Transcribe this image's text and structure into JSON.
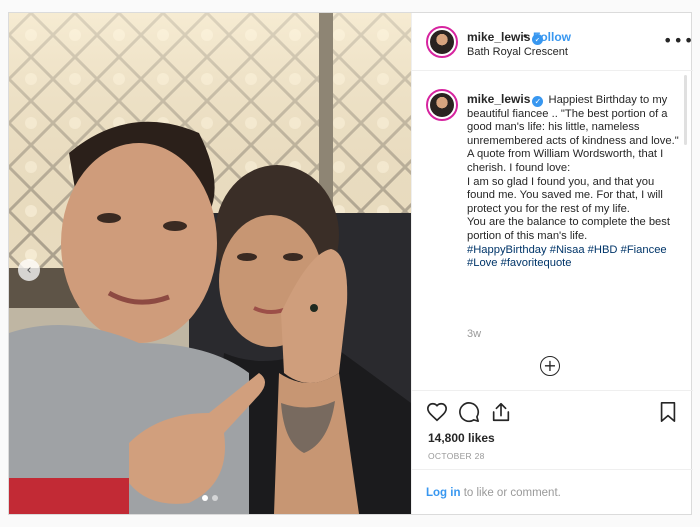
{
  "header": {
    "username": "mike_lewis",
    "bullet": "•",
    "follow_label": "Follow",
    "location": "Bath Royal Crescent",
    "more_label": "•••"
  },
  "caption": {
    "username": "mike_lewis",
    "lines": [
      "Happiest Birthday to my beautiful fiancee .. \"The best portion of a good man's life: his little, nameless unremembered acts of kindness and love.\"",
      "A quote from William Wordsworth, that I cherish. I found love:",
      "I am so glad I found you, and that you found me. You saved me. For that, I will protect you for the rest of my life.",
      "You are the balance to complete the best portion of this man's life."
    ],
    "hashtags": [
      "#HappyBirthday",
      "#Nisaa",
      "#HBD",
      "#Fiancee",
      "#Love",
      "#favoritequote"
    ],
    "time_ago": "3w",
    "load_more_label": "+"
  },
  "actions": {
    "like_icon": "heart-icon",
    "comment_icon": "comment-bubble-icon",
    "share_icon": "share-icon",
    "save_icon": "bookmark-icon"
  },
  "likes_text": "14,800 likes",
  "date": "OCTOBER 28",
  "footer": {
    "login_label": "Log in",
    "rest_text": " to like or comment."
  },
  "carousel": {
    "prev_label": "‹",
    "current_index": 1,
    "count": 2
  },
  "colors": {
    "link_blue": "#3897f0",
    "hashtag_blue": "#003569",
    "muted": "#999999",
    "border": "#dbdbdb"
  }
}
